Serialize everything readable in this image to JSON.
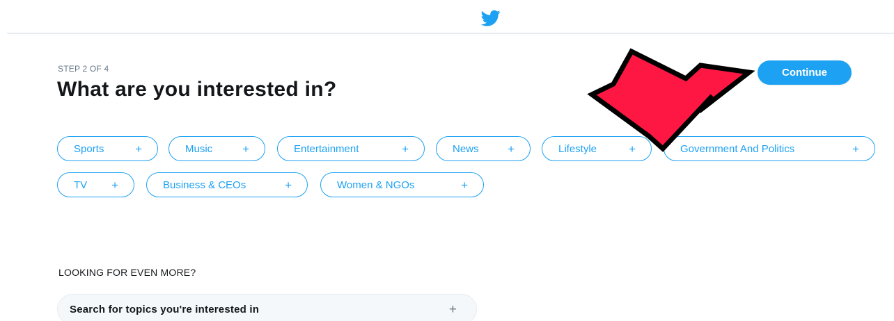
{
  "header": {
    "logo_icon": "twitter-bird-icon",
    "brand_color": "#1da1f2"
  },
  "onboarding": {
    "step_label": "STEP 2 OF 4",
    "title": "What are you interested in?",
    "continue_label": "Continue"
  },
  "topics": [
    {
      "label": "Sports",
      "plus": "+"
    },
    {
      "label": "Music",
      "plus": "+"
    },
    {
      "label": "Entertainment",
      "plus": "+"
    },
    {
      "label": "News",
      "plus": "+"
    },
    {
      "label": "Lifestyle",
      "plus": "+"
    },
    {
      "label": "Government And Politics",
      "plus": "+"
    },
    {
      "label": "TV",
      "plus": "+"
    },
    {
      "label": "Business & CEOs",
      "plus": "+"
    },
    {
      "label": "Women & NGOs",
      "plus": "+"
    }
  ],
  "more": {
    "heading": "LOOKING FOR EVEN MORE?",
    "search_placeholder": "Search for topics you're interested in",
    "search_plus": "+"
  },
  "annotation": {
    "arrow_color": "#ff1744",
    "arrow_outline": "#000000"
  }
}
